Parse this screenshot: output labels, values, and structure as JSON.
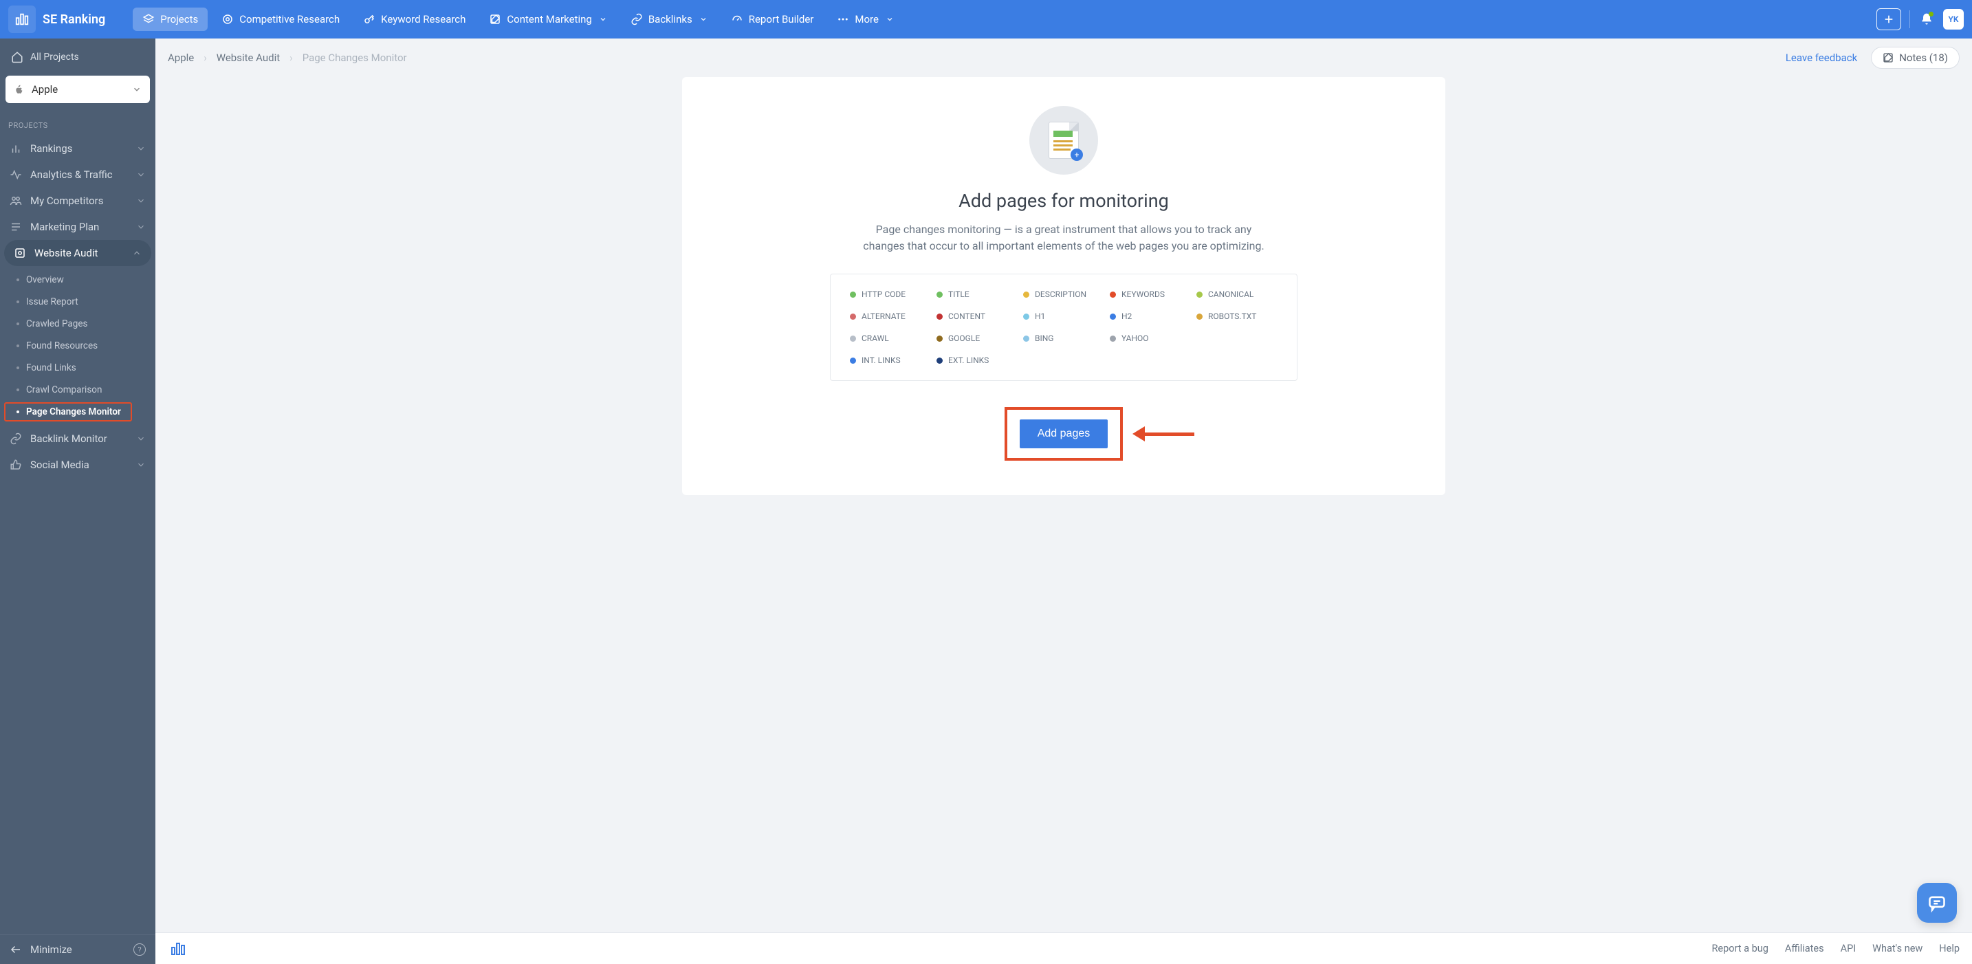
{
  "brand": "SE Ranking",
  "topnav": {
    "projects": "Projects",
    "competitive": "Competitive Research",
    "keyword": "Keyword Research",
    "content": "Content Marketing",
    "backlinks": "Backlinks",
    "report": "Report Builder",
    "more": "More"
  },
  "user_initials": "YK",
  "sidebar": {
    "all_projects": "All Projects",
    "selected_project": "Apple",
    "section_label": "PROJECTS",
    "items": {
      "rankings": "Rankings",
      "analytics": "Analytics & Traffic",
      "competitors": "My Competitors",
      "marketing": "Marketing Plan",
      "audit": "Website Audit",
      "backlink_monitor": "Backlink Monitor",
      "social": "Social Media"
    },
    "audit_sub": {
      "overview": "Overview",
      "issue": "Issue Report",
      "crawled": "Crawled Pages",
      "resources": "Found Resources",
      "links": "Found Links",
      "comparison": "Crawl Comparison",
      "pagechanges": "Page Changes Monitor"
    },
    "minimize": "Minimize"
  },
  "breadcrumb": {
    "a": "Apple",
    "b": "Website Audit",
    "c": "Page Changes Monitor"
  },
  "feedback": "Leave feedback",
  "notes_label": "Notes (18)",
  "empty": {
    "title": "Add pages for monitoring",
    "desc": "Page changes monitoring — is a great instrument that allows you to track any changes that occur to all important elements of the web pages you are optimizing."
  },
  "tags": [
    {
      "label": "HTTP CODE",
      "color": "#6FBF60"
    },
    {
      "label": "TITLE",
      "color": "#6FBF60"
    },
    {
      "label": "DESCRIPTION",
      "color": "#E6B83D"
    },
    {
      "label": "KEYWORDS",
      "color": "#E24C29"
    },
    {
      "label": "CANONICAL",
      "color": "#A6C84A"
    },
    {
      "label": "ALTERNATE",
      "color": "#D46A6A"
    },
    {
      "label": "CONTENT",
      "color": "#C23333"
    },
    {
      "label": "H1",
      "color": "#7DC9E6"
    },
    {
      "label": "H2",
      "color": "#3B7DE3"
    },
    {
      "label": "ROBOTS.TXT",
      "color": "#D9A63B"
    },
    {
      "label": "CRAWL",
      "color": "#B7BEC8"
    },
    {
      "label": "GOOGLE",
      "color": "#8F6B1F"
    },
    {
      "label": "BING",
      "color": "#8CC6E6"
    },
    {
      "label": "YAHOO",
      "color": "#9DA3AC"
    },
    {
      "label": "",
      "color": ""
    },
    {
      "label": "INT. LINKS",
      "color": "#3B7DE3"
    },
    {
      "label": "EXT. LINKS",
      "color": "#1F3F7A"
    }
  ],
  "cta": "Add pages",
  "footer": {
    "bug": "Report a bug",
    "affiliates": "Affiliates",
    "api": "API",
    "whatsnew": "What's new",
    "help": "Help"
  }
}
